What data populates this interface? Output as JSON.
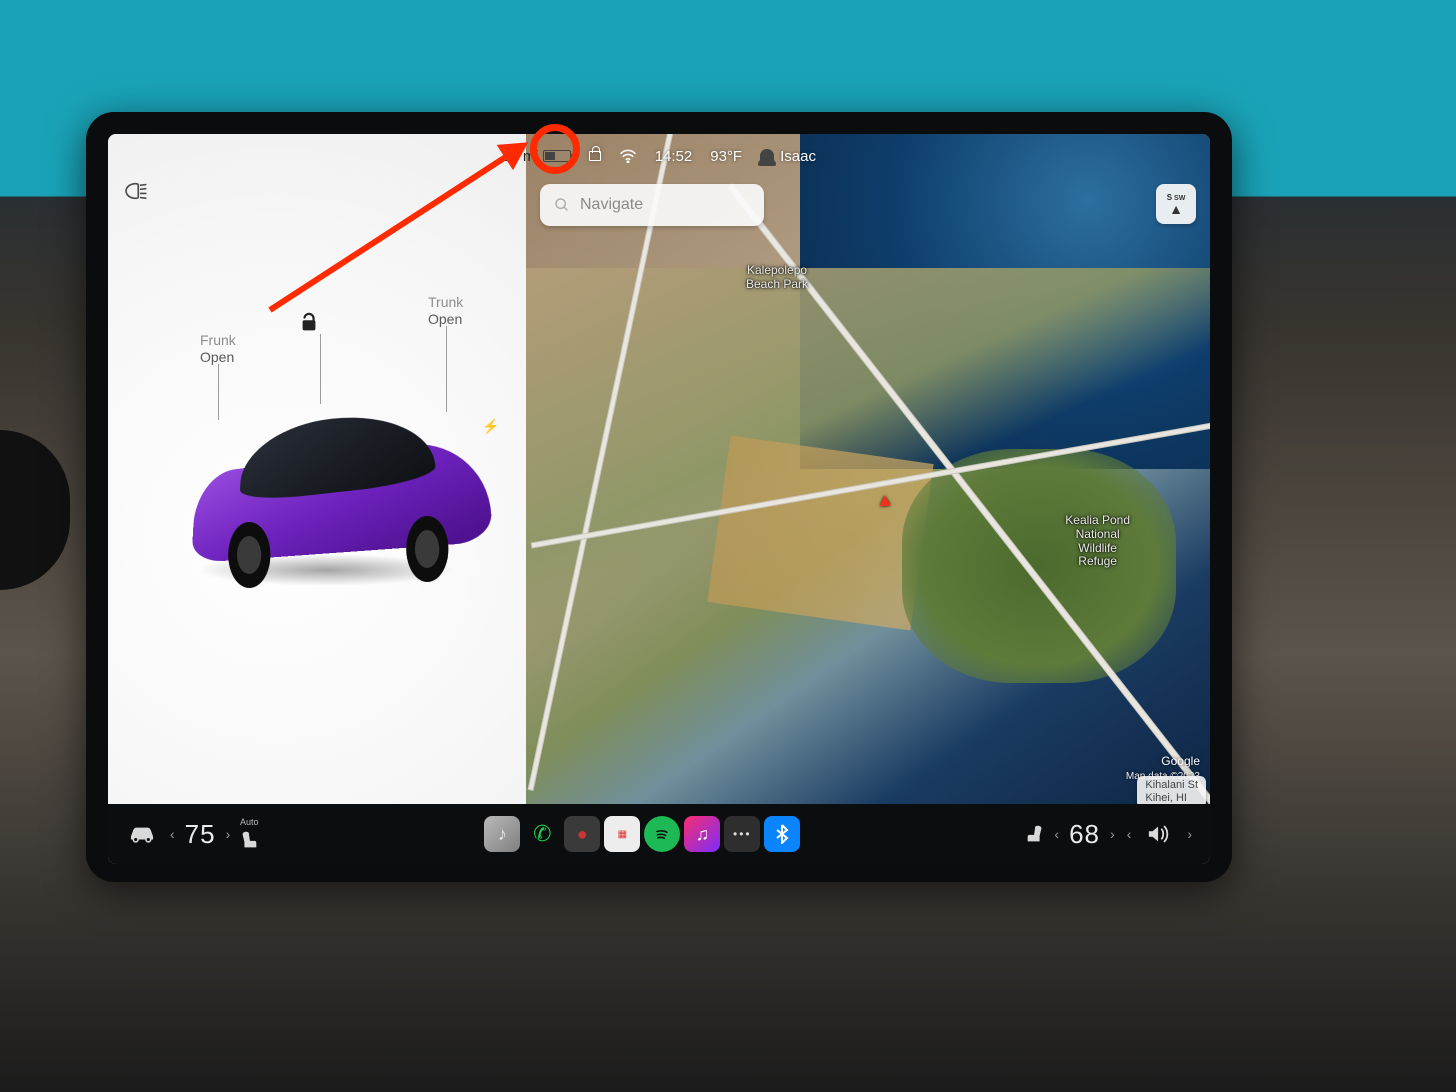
{
  "statusbar": {
    "range": "84 mi",
    "time": "14:52",
    "temperature": "93°F",
    "profile_name": "Isaac"
  },
  "car_panel": {
    "frunk": {
      "title": "Frunk",
      "state": "Open"
    },
    "trunk": {
      "title": "Trunk",
      "state": "Open"
    }
  },
  "map": {
    "search_placeholder": "Navigate",
    "compass": {
      "cardinal": "S",
      "sub": "SW"
    },
    "labels": {
      "beach_park": "Kalepolepo\nBeach Park",
      "refuge": "Kealia Pond\nNational\nWildlife\nRefuge"
    },
    "credit": "Google",
    "map_data": "Map data ©2023",
    "street": {
      "name": "Kihalani St",
      "city": "Kihei, HI"
    }
  },
  "bottombar": {
    "driver_temp": "75",
    "passenger_temp": "68",
    "seat_mode": "Auto"
  }
}
